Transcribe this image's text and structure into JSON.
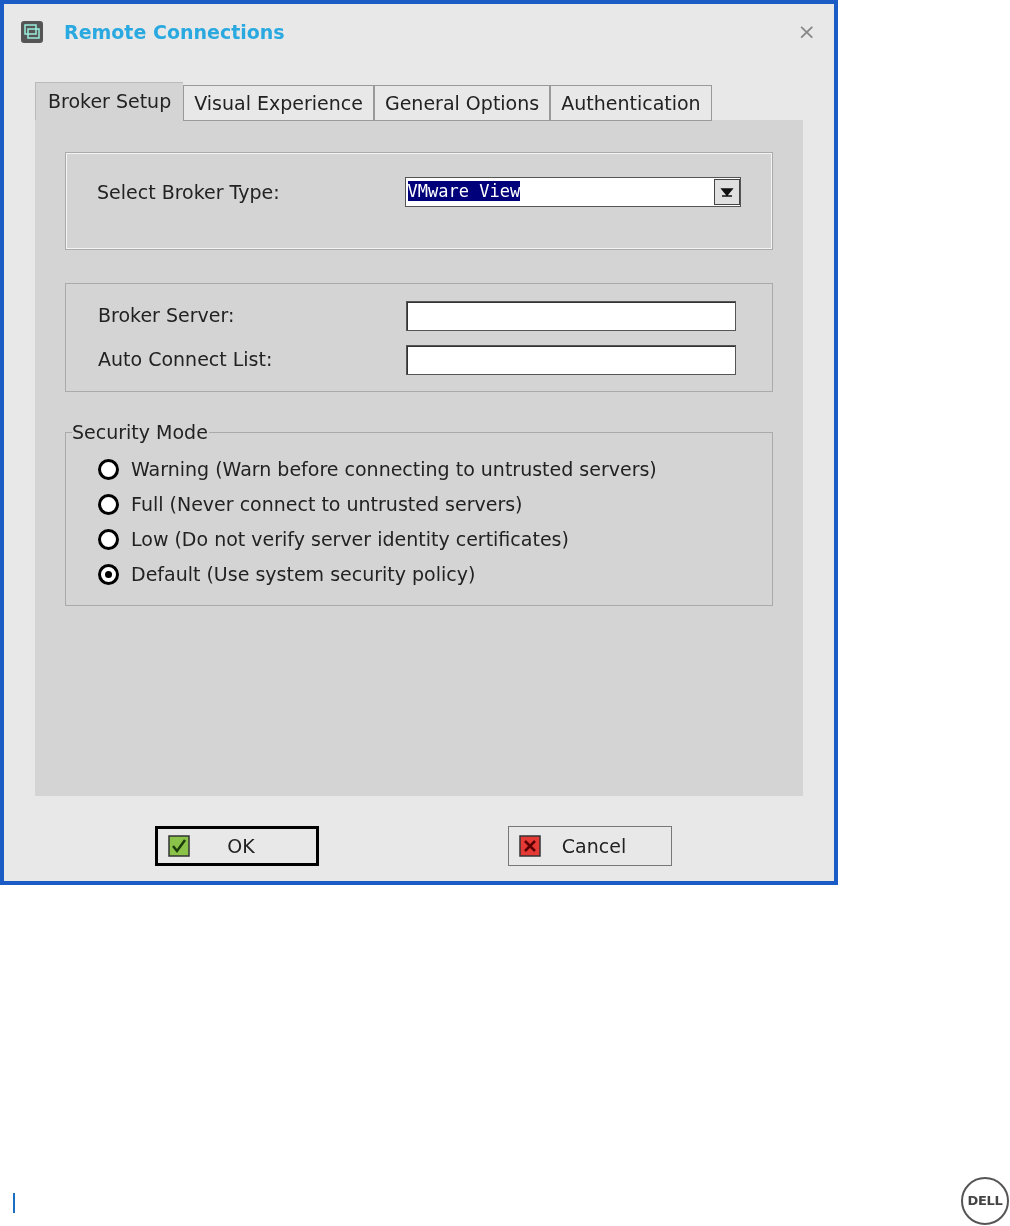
{
  "window": {
    "title": "Remote Connections",
    "close": "×"
  },
  "tabs": [
    {
      "label": "Broker Setup",
      "selected": true
    },
    {
      "label": "Visual Experience",
      "selected": false
    },
    {
      "label": "General Options",
      "selected": false
    },
    {
      "label": "Authentication",
      "selected": false
    }
  ],
  "broker_type": {
    "label": "Select Broker Type:",
    "value": "VMware View"
  },
  "fields": [
    {
      "label": "Broker Server:"
    },
    {
      "label": "Auto Connect List:"
    }
  ],
  "security_mode": {
    "title": "Security Mode",
    "options": [
      {
        "label": "Warning (Warn before connecting to untrusted servers)",
        "selected": false
      },
      {
        "label": "Full (Never connect to untrusted servers)",
        "selected": false
      },
      {
        "label": "Low (Do not verify server identity certificates)",
        "selected": false
      },
      {
        "label": "Default (Use system security policy)",
        "selected": true
      }
    ]
  },
  "buttons": [
    {
      "label": "OK",
      "kind": "ok",
      "default": true
    },
    {
      "label": "Cancel",
      "kind": "cancel",
      "default": false
    }
  ],
  "footer": {
    "logo": "DELL"
  }
}
